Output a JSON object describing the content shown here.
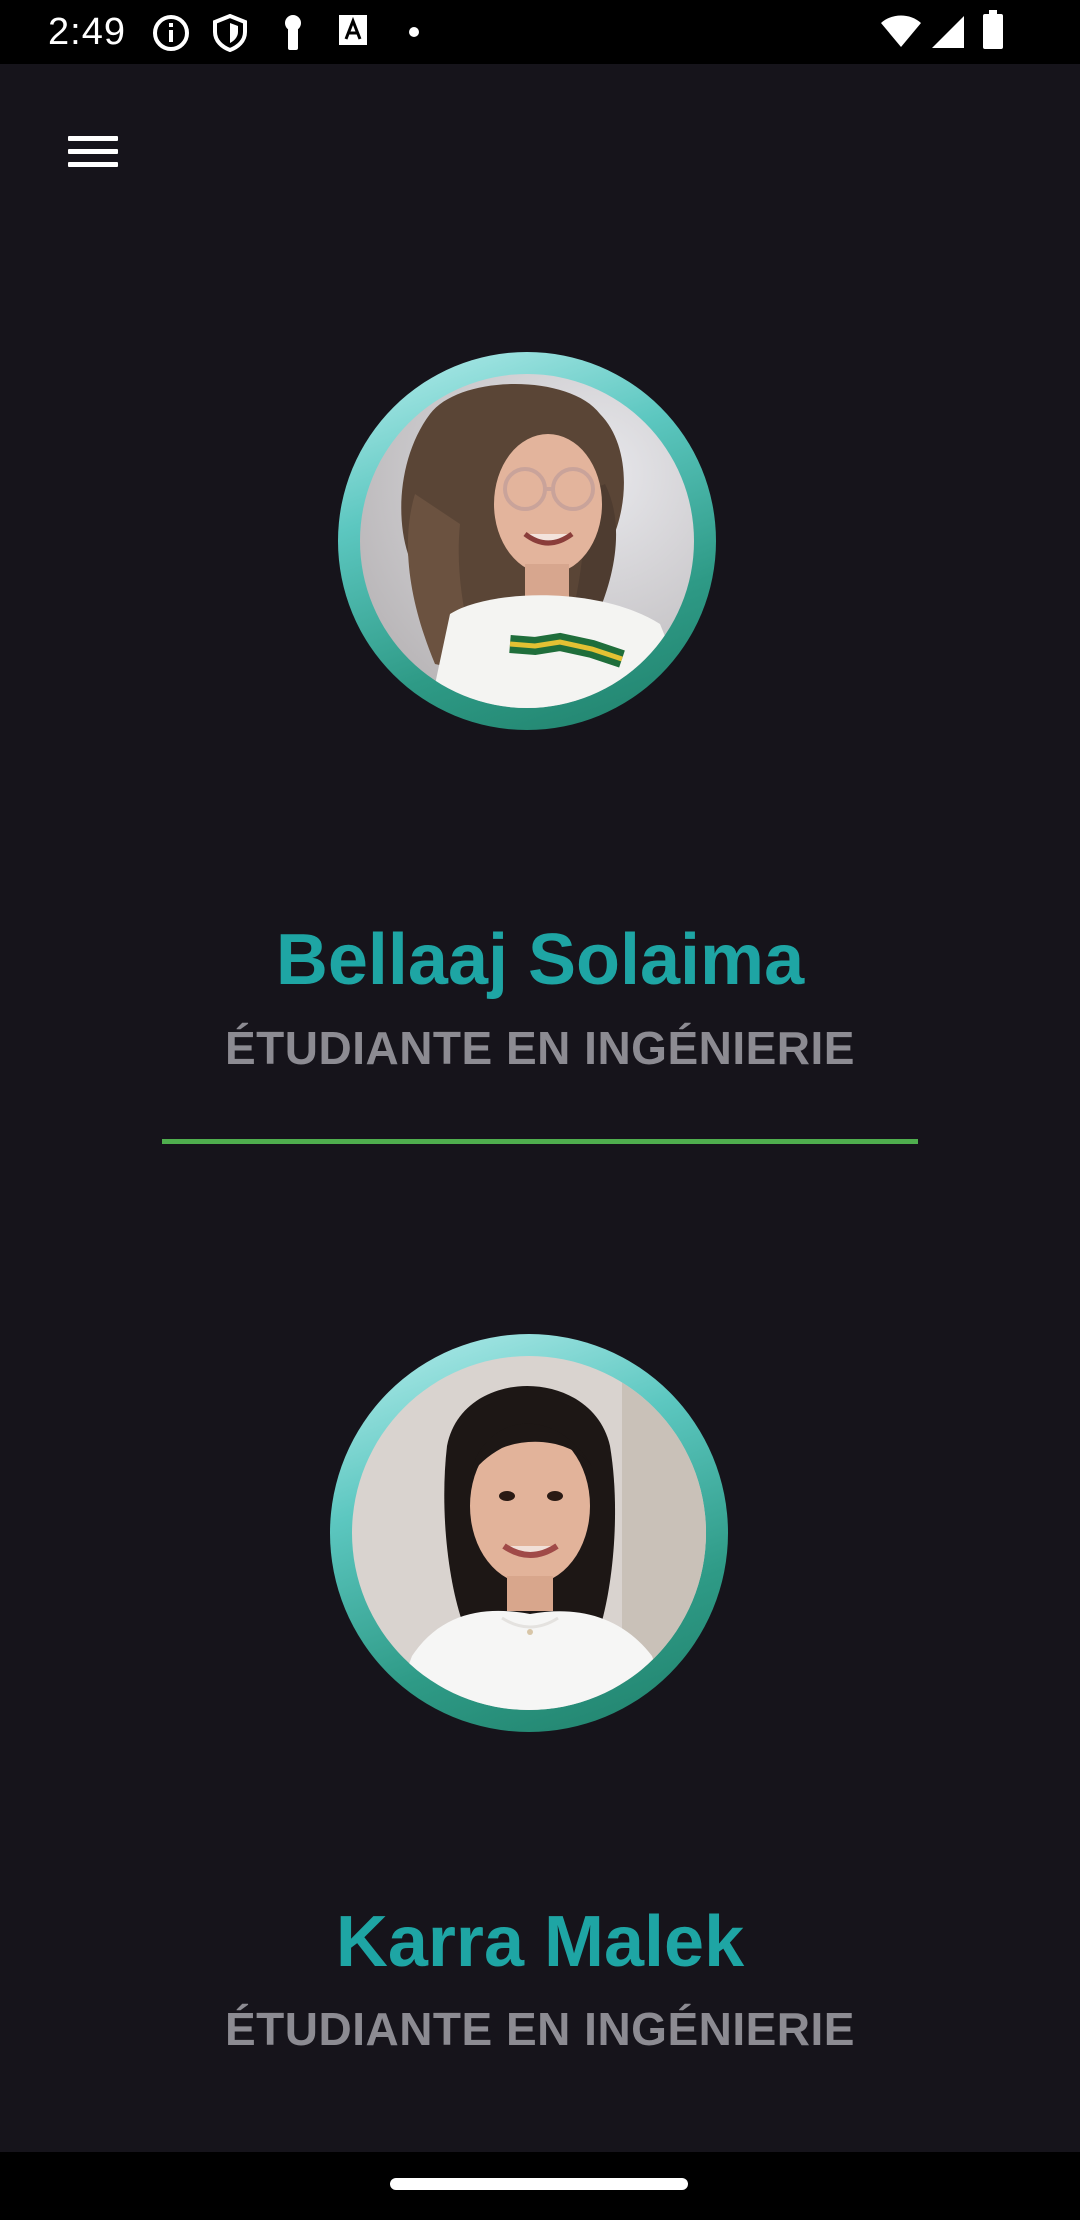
{
  "status_bar": {
    "time": "2:49",
    "left_icons": [
      "info-icon",
      "shield-icon",
      "key-icon",
      "font-a-icon",
      "dot-icon"
    ],
    "right_icons": [
      "wifi-icon",
      "cellular-signal-icon",
      "battery-icon"
    ]
  },
  "app_bar": {
    "menu_icon": "hamburger-menu-icon"
  },
  "profiles": [
    {
      "name": "Bellaaj Solaima",
      "role": "ÉTUDIANTE EN INGÉNIERIE"
    },
    {
      "name": "Karra Malek",
      "role": "ÉTUDIANTE EN INGÉNIERIE"
    }
  ],
  "colors": {
    "background": "#16141b",
    "name_accent": "#1ea5a4",
    "role_text": "#8c8b92",
    "divider": "#4fae4e",
    "avatar_ring_light": "#b8eeee",
    "avatar_ring_dark": "#1f7f69"
  }
}
